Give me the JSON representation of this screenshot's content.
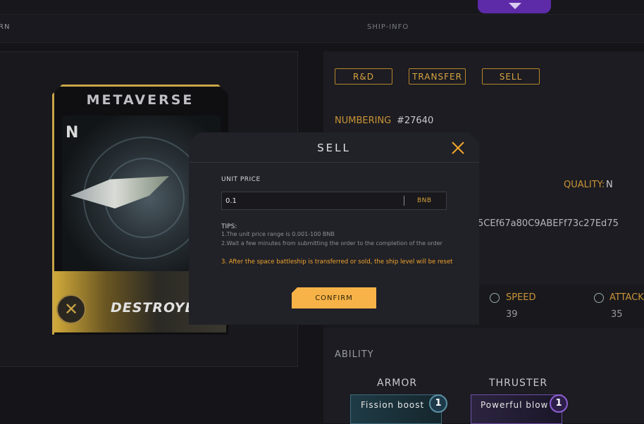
{
  "header": {
    "back_label": "RN",
    "page_label": "SHIP-INFO"
  },
  "card": {
    "title": "METAVERSE",
    "quality_letter": "N",
    "class_name": "DESTROYER"
  },
  "actions": {
    "rd_label": "R&D",
    "transfer_label": "TRANSFER",
    "sell_label": "SELL"
  },
  "info": {
    "numbering_label": "NUMBERING",
    "numbering_value": "#27640",
    "quality_label": "QUALITY:",
    "quality_value": "N",
    "address_fragment": "5CEf67a80C9ABEFf73c27Ed75"
  },
  "stats": [
    {
      "label": "SPEED",
      "value": "39",
      "icon": "speed-icon"
    },
    {
      "label": "ATTACK",
      "value": "35",
      "icon": "attack-icon"
    }
  ],
  "ability": {
    "section_label": "ABILITY",
    "items": [
      {
        "slot": "ARMOR",
        "name": "Fission boost",
        "level": "1",
        "color": "#3e6b7a"
      },
      {
        "slot": "THRUSTER",
        "name": "Powerful blow",
        "level": "1",
        "color": "#6e4fa5"
      }
    ]
  },
  "modal": {
    "title": "SELL",
    "unit_price_label": "UNIT PRICE",
    "unit_price_value": "0.1",
    "currency": "BNB",
    "tips_title": "TIPS:",
    "tips": [
      "1.The unit price range is 0.001-100 BNB",
      "2.Wait a few minutes from submitting the order to the completion of the order",
      "3. After the space battleship is transferred or sold, the ship level will be reset"
    ],
    "confirm_label": "CONFIRM"
  },
  "colors": {
    "accent": "#f7b347",
    "gold_text": "#c99436",
    "warning": "#f0a52c"
  }
}
